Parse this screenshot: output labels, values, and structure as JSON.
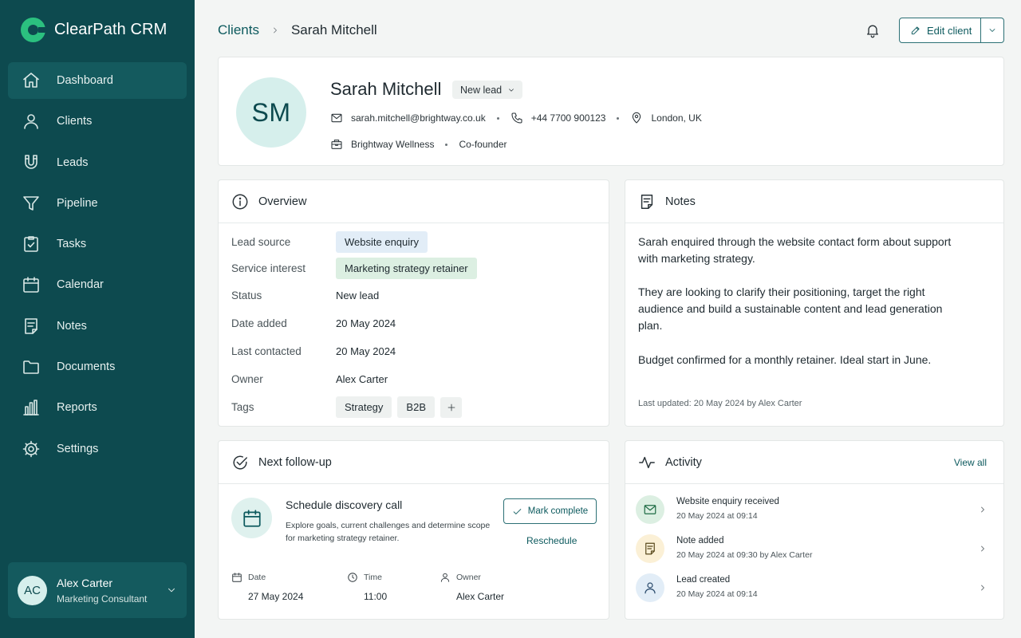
{
  "app": {
    "name": "ClearPath CRM"
  },
  "sidebar": {
    "items": [
      {
        "label": "Dashboard",
        "icon": "home-icon",
        "active": true
      },
      {
        "label": "Clients",
        "icon": "user-icon"
      },
      {
        "label": "Leads",
        "icon": "magnet-icon"
      },
      {
        "label": "Pipeline",
        "icon": "funnel-icon"
      },
      {
        "label": "Tasks",
        "icon": "clipboard-check-icon"
      },
      {
        "label": "Calendar",
        "icon": "calendar-icon"
      },
      {
        "label": "Notes",
        "icon": "note-icon"
      },
      {
        "label": "Documents",
        "icon": "folder-icon"
      },
      {
        "label": "Reports",
        "icon": "bar-chart-icon"
      },
      {
        "label": "Settings",
        "icon": "gear-icon"
      }
    ],
    "user": {
      "initials": "AC",
      "name": "Alex Carter",
      "role": "Marketing Consultant"
    }
  },
  "header": {
    "breadcrumb": {
      "parent": "Clients",
      "current": "Sarah Mitchell"
    },
    "edit_label": "Edit client"
  },
  "profile": {
    "initials": "SM",
    "name": "Sarah Mitchell",
    "status": "New lead",
    "email": "sarah.mitchell@brightway.co.uk",
    "phone": "+44 7700 900123",
    "location": "London, UK",
    "company": "Brightway Wellness",
    "title": "Co-founder"
  },
  "overview": {
    "title": "Overview",
    "fields": [
      {
        "label": "Lead source",
        "value": "Website enquiry"
      },
      {
        "label": "Service interest",
        "value": "Marketing strategy retainer"
      },
      {
        "label": "Status",
        "value": "New lead"
      },
      {
        "label": "Date added",
        "value": "20 May 2024"
      },
      {
        "label": "Last contacted",
        "value": "20 May 2024"
      },
      {
        "label": "Owner",
        "value": "Alex Carter"
      }
    ],
    "tags_label": "Tags",
    "tags": [
      "Strategy",
      "B2B"
    ]
  },
  "notes": {
    "title": "Notes",
    "paragraphs": [
      "Sarah enquired through the website contact form about support with marketing strategy.",
      "They are looking to clarify their positioning, target the right audience and build a sustainable content and lead generation plan.",
      "Budget confirmed for a monthly retainer. Ideal start in June."
    ],
    "updated": "Last updated: 20 May 2024 by Alex Carter"
  },
  "followup": {
    "title": "Next follow-up",
    "task_title": "Schedule discovery call",
    "task_desc": "Explore goals, current challenges and determine scope for marketing strategy retainer.",
    "mark_label": "Mark complete",
    "reschedule_label": "Reschedule",
    "date_label": "Date",
    "date": "27 May 2024",
    "time_label": "Time",
    "time": "11:00",
    "owner_label": "Owner",
    "owner": "Alex Carter"
  },
  "activity": {
    "title": "Activity",
    "view_all": "View all",
    "items": [
      {
        "title": "Website enquiry received",
        "time": "20 May 2024 at 09:14",
        "icon": "mail-icon",
        "color": "#dcefe2"
      },
      {
        "title": "Note added",
        "time": "20 May 2024 at 09:30 by Alex Carter",
        "icon": "note-icon",
        "color": "#fbf0d6"
      },
      {
        "title": "Lead created",
        "time": "20 May 2024 at 09:14",
        "icon": "user-icon",
        "color": "#e2edf7"
      }
    ]
  },
  "colors": {
    "sidebar": "#0d4a4f",
    "accent": "#0d5a5e",
    "brand": "#2bc07f"
  }
}
